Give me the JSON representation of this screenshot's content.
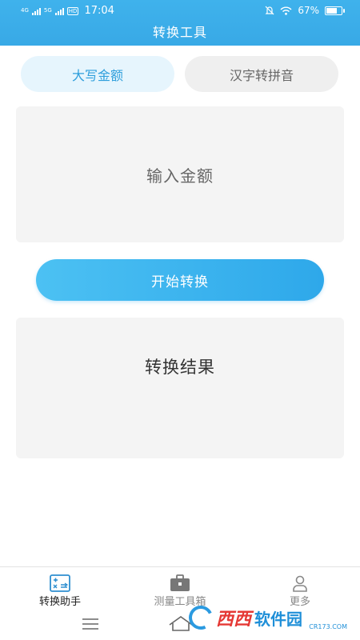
{
  "status_bar": {
    "network_left": "4G",
    "network_right": "5G",
    "hd": "HD",
    "time": "17:04",
    "battery": "67%",
    "battery_level": 0.67
  },
  "header": {
    "title": "转换工具"
  },
  "tabs": [
    {
      "label": "大写金额",
      "active": true
    },
    {
      "label": "汉字转拼音",
      "active": false
    }
  ],
  "input": {
    "placeholder": "输入金额"
  },
  "convert_button": {
    "label": "开始转换"
  },
  "result": {
    "label": "转换结果"
  },
  "bottom_nav": [
    {
      "label": "转换助手",
      "icon": "calculator-icon",
      "active": true
    },
    {
      "label": "测量工具箱",
      "icon": "toolbox-icon",
      "active": false
    },
    {
      "label": "更多",
      "icon": "person-icon",
      "active": false
    }
  ],
  "watermark": {
    "brand_red": "西西",
    "brand_blue": "软件园",
    "domain": "CR173.COM"
  },
  "colors": {
    "accent": "#38a9e6",
    "accent_light": "#e6f5fd",
    "card_bg": "#f4f4f4"
  }
}
